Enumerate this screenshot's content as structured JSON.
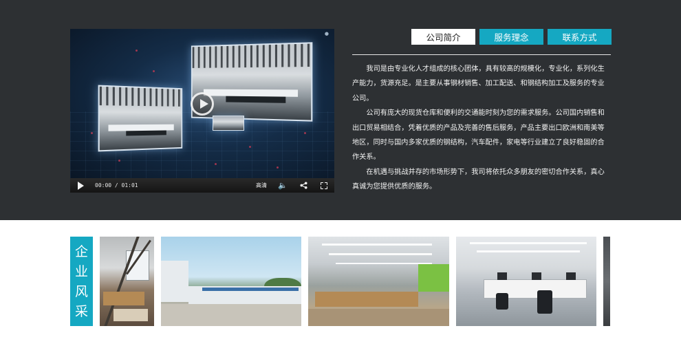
{
  "video": {
    "time": "00:00 / 01:01",
    "quality_label": "高清",
    "play_icon": "play-icon",
    "volume_icon": "volume-icon",
    "share_icon": "share-icon",
    "fullscreen_icon": "fullscreen-icon"
  },
  "tabs": [
    {
      "label": "公司简介",
      "active": true
    },
    {
      "label": "服务理念",
      "active": false
    },
    {
      "label": "联系方式",
      "active": false
    }
  ],
  "intro": {
    "paragraphs": [
      "我司是由专业化人才组成的核心团体，具有较高的规模化，专业化，系列化生产能力，货源充足。是主要从事钢材销售、加工配送、和钢结构加工及服务的专业公司。",
      "公司有庞大的现货仓库和便利的交通能时刻为您的需求服务。公司国内销售和出口贸易相结合，凭着优质的产品及完善的售后服务，产品主要出口欧洲和南美等地区，同时与国内多家优质的钢结构，汽车配件，家电等行业建立了良好稳固的合作关系。",
      "在机遇与挑战并存的市场形势下，我司将依托众多朋友的密切合作关系，真心真诚为您提供优质的服务。"
    ]
  },
  "gallery": {
    "label_chars": [
      "企",
      "业",
      "风",
      "采"
    ]
  },
  "colors": {
    "dark_band": "#2d3033",
    "accent": "#15a8c2",
    "text_light": "#f2f2f2"
  }
}
